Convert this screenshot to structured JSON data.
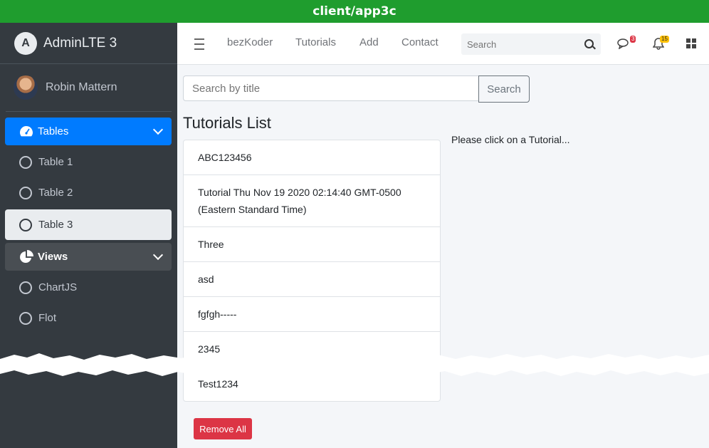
{
  "window": {
    "title": "client/app3c"
  },
  "brand": {
    "name": "AdminLTE 3",
    "logo_letter": "A"
  },
  "user": {
    "name": "Robin Mattern"
  },
  "sidebar": {
    "items": [
      {
        "label": "Tables",
        "icon": "tachometer-icon",
        "state": "active"
      },
      {
        "label": "Table 1",
        "icon": "circle-icon"
      },
      {
        "label": "Table 2",
        "icon": "circle-icon"
      },
      {
        "label": "Table 3",
        "icon": "circle-icon",
        "state": "selected"
      },
      {
        "label": "Views",
        "icon": "pie-chart-icon",
        "state": "header"
      },
      {
        "label": "ChartJS",
        "icon": "circle-icon"
      },
      {
        "label": "Flot",
        "icon": "circle-icon"
      }
    ]
  },
  "navbar": {
    "links": [
      "bezKoder",
      "Tutorials",
      "Add",
      "Contact"
    ],
    "search_placeholder": "Search",
    "messages_count": "3",
    "notifications_count": "15"
  },
  "main": {
    "search_placeholder": "Search by title",
    "search_button": "Search",
    "list_title": "Tutorials List",
    "tutorials": [
      "ABC123456",
      "Tutorial Thu Nov 19 2020 02:14:40 GMT-0500 (Eastern Standard Time)",
      "Three",
      "asd",
      "fgfgh-----",
      "2345",
      "Test1234"
    ],
    "hint": "Please click on a Tutorial...",
    "remove_all": "Remove All"
  },
  "colors": {
    "brand_green": "#1f9d2e",
    "primary": "#007bff",
    "danger": "#dc3545",
    "sidebar_bg": "#343a40"
  }
}
